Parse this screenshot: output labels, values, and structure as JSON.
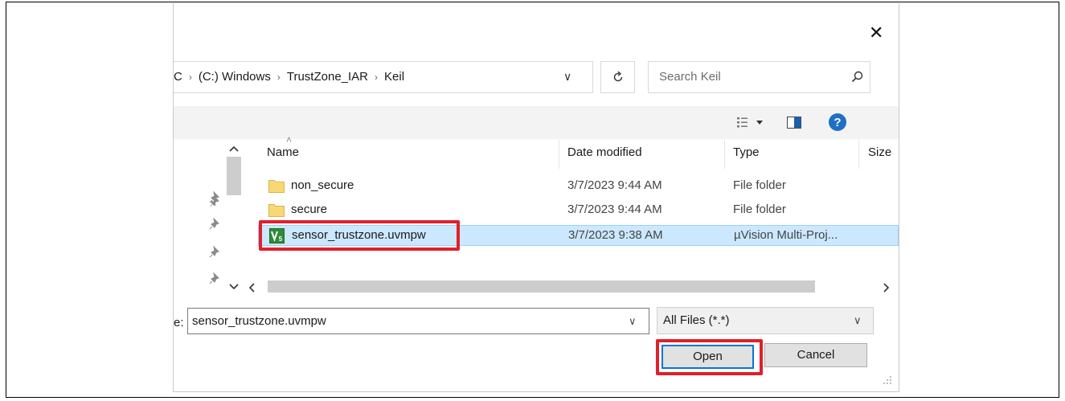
{
  "window": {
    "close_glyph": "✕"
  },
  "address_bar": {
    "crumbs": [
      "C",
      "(C:) Windows",
      "TrustZone_IAR",
      "Keil"
    ],
    "separator": "›",
    "dropdown_glyph": "∨",
    "refresh_icon": "refresh-icon"
  },
  "search": {
    "placeholder": "Search Keil",
    "icon": "search-icon"
  },
  "toolbar": {
    "view_icon": "view-options-icon",
    "preview_icon": "preview-pane-icon",
    "help_icon": "help-icon"
  },
  "columns": {
    "name": "Name",
    "date": "Date modified",
    "type": "Type",
    "size": "Size"
  },
  "files": [
    {
      "name": "non_secure",
      "date": "3/7/2023 9:44 AM",
      "type": "File folder",
      "icon": "folder-icon",
      "selected": false
    },
    {
      "name": "secure",
      "date": "3/7/2023 9:44 AM",
      "type": "File folder",
      "icon": "folder-icon",
      "selected": false
    },
    {
      "name": "sensor_trustzone.uvmpw",
      "date": "3/7/2023 9:38 AM",
      "type": "µVision Multi-Proj...",
      "icon": "uvision-project-icon",
      "selected": true
    }
  ],
  "file_name": {
    "label": "e:",
    "value": "sensor_trustzone.uvmpw"
  },
  "file_type": {
    "value": "All Files (*.*)"
  },
  "buttons": {
    "open": "Open",
    "cancel": "Cancel"
  },
  "colors": {
    "highlight": "#e0202b",
    "selection": "#cce8ff",
    "focus": "#0078d7"
  }
}
